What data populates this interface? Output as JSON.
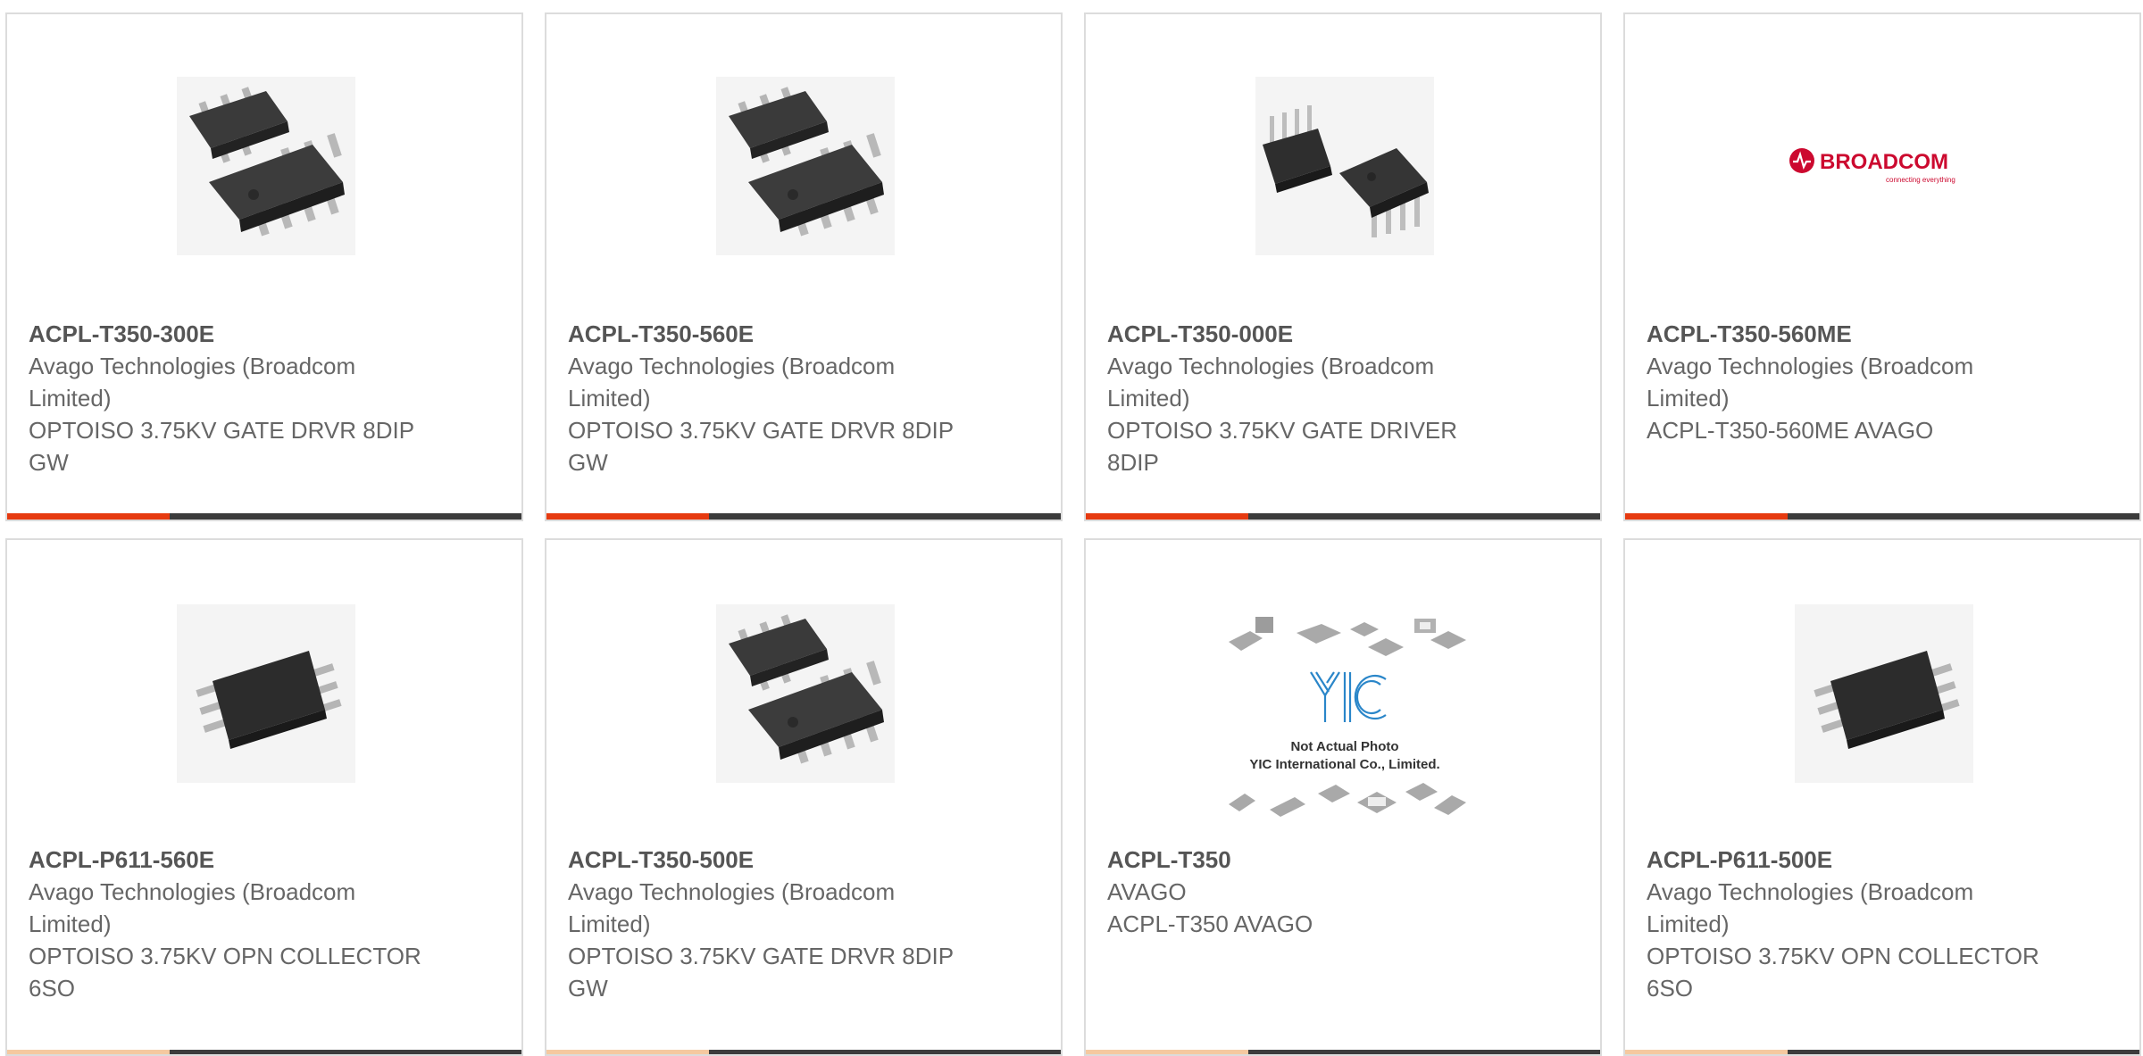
{
  "colors": {
    "accent_orange": "#e63a10",
    "accent_dark": "#3c3c3c",
    "card_border": "#dcdcdc",
    "title_text": "#555555",
    "body_text": "#666666",
    "broadcom_red": "#cc092f"
  },
  "products": [
    {
      "part_number": "ACPL-T350-300E",
      "manufacturer": "Avago Technologies (Broadcom Limited)",
      "description": "OPTOISO 3.75KV GATE DRVR 8DIP GW",
      "image_icon": "smd-chip-pair-image"
    },
    {
      "part_number": "ACPL-T350-560E",
      "manufacturer": "Avago Technologies (Broadcom Limited)",
      "description": "OPTOISO 3.75KV GATE DRVR 8DIP GW",
      "image_icon": "smd-chip-pair-image"
    },
    {
      "part_number": "ACPL-T350-000E",
      "manufacturer": "Avago Technologies (Broadcom Limited)",
      "description": "OPTOISO 3.75KV GATE DRIVER 8DIP",
      "image_icon": "dip-chip-pair-image"
    },
    {
      "part_number": "ACPL-T350-560ME",
      "manufacturer": "Avago Technologies (Broadcom Limited)",
      "description": "ACPL-T350-560ME AVAGO",
      "image_icon": "broadcom-logo",
      "logo_text": "BROADCOM",
      "logo_tagline": "connecting everything"
    },
    {
      "part_number": "ACPL-P611-560E",
      "manufacturer": "Avago Technologies (Broadcom Limited)",
      "description": "OPTOISO 3.75KV OPN COLLECTOR 6SO",
      "image_icon": "so6-chip-image"
    },
    {
      "part_number": "ACPL-T350-500E",
      "manufacturer": "Avago Technologies (Broadcom Limited)",
      "description": "OPTOISO 3.75KV GATE DRVR 8DIP GW",
      "image_icon": "smd-chip-pair-image"
    },
    {
      "part_number": "ACPL-T350",
      "manufacturer": "AVAGO",
      "description": "ACPL-T350 AVAGO",
      "image_icon": "yic-placeholder-image",
      "placeholder_line1": "Not Actual Photo",
      "placeholder_line2": "YIC International Co., Limited."
    },
    {
      "part_number": "ACPL-P611-500E",
      "manufacturer": "Avago Technologies (Broadcom Limited)",
      "description": "OPTOISO 3.75KV OPN COLLECTOR 6SO",
      "image_icon": "so6-chip-image"
    }
  ]
}
